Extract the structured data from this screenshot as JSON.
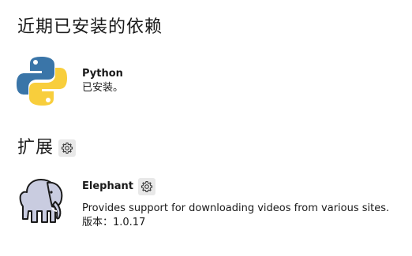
{
  "recent": {
    "title": "近期已安装的依赖",
    "items": [
      {
        "name": "Python",
        "status": "已安装。",
        "icon": "python-logo-icon"
      }
    ]
  },
  "extensions": {
    "title": "扩展",
    "settings_icon": "gear-icon",
    "items": [
      {
        "name": "Elephant",
        "description": "Provides support for downloading videos from various sites.",
        "version_text": "版本：1.0.17",
        "icon": "elephant-icon",
        "settings_icon": "gear-icon"
      }
    ]
  },
  "colors": {
    "python_blue": "#3a75a8",
    "python_yellow": "#f8ce3c",
    "button_bg": "#e8e8e8",
    "elephant_fill": "#c9cce0"
  }
}
